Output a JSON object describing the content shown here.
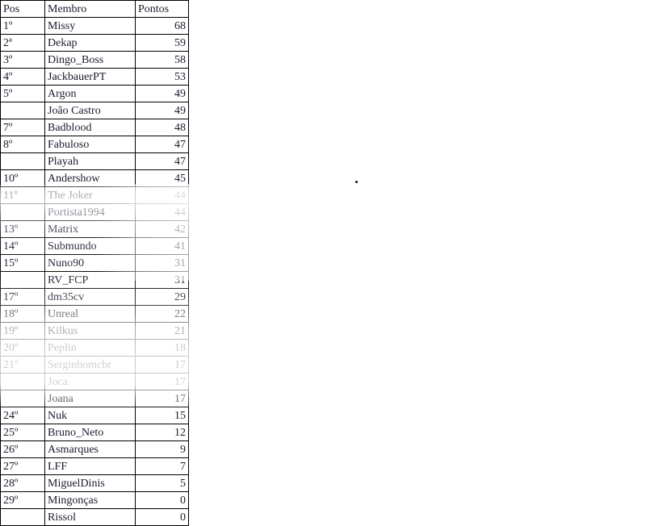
{
  "table": {
    "headers": {
      "pos": "Pos",
      "member": "Membro",
      "points": "Pontos"
    },
    "rows": [
      {
        "pos": "1º",
        "member": "Missy",
        "points": "68"
      },
      {
        "pos": "2ª",
        "member": "Dekap",
        "points": "59"
      },
      {
        "pos": "3º",
        "member": "Dingo_Boss",
        "points": "58"
      },
      {
        "pos": "4º",
        "member": "JackbauerPT",
        "points": "53"
      },
      {
        "pos": "5º",
        "member": "Argon",
        "points": "49"
      },
      {
        "pos": "",
        "member": "João Castro",
        "points": "49"
      },
      {
        "pos": "7º",
        "member": "Badblood",
        "points": "48"
      },
      {
        "pos": "8º",
        "member": "Fabuloso",
        "points": "47"
      },
      {
        "pos": "",
        "member": "Playah",
        "points": "47"
      },
      {
        "pos": "10º",
        "member": "Andershow",
        "points": "45"
      },
      {
        "pos": "11º",
        "member": "The Joker",
        "points": "44"
      },
      {
        "pos": "",
        "member": "Portista1994",
        "points": "44"
      },
      {
        "pos": "13º",
        "member": "Matrix",
        "points": "42"
      },
      {
        "pos": "14º",
        "member": "Submundo",
        "points": "41"
      },
      {
        "pos": "15º",
        "member": "Nuno90",
        "points": "31"
      },
      {
        "pos": "",
        "member": "RV_FCP",
        "points": "31"
      },
      {
        "pos": "17º",
        "member": "dm35cv",
        "points": "29"
      },
      {
        "pos": "18º",
        "member": "Unreal",
        "points": "22"
      },
      {
        "pos": "19º",
        "member": "Kilkus",
        "points": "21"
      },
      {
        "pos": "20º",
        "member": "Peplin",
        "points": "18"
      },
      {
        "pos": "21º",
        "member": "Serginhomcbr",
        "points": "17"
      },
      {
        "pos": "",
        "member": "Joca",
        "points": "17"
      },
      {
        "pos": "",
        "member": "Joana",
        "points": "17"
      },
      {
        "pos": "24º",
        "member": "Nuk",
        "points": "15"
      },
      {
        "pos": "25º",
        "member": "Bruno_Neto",
        "points": "12"
      },
      {
        "pos": "26º",
        "member": "Asmarques",
        "points": "9"
      },
      {
        "pos": "27º",
        "member": "LFF",
        "points": "7"
      },
      {
        "pos": "28º",
        "member": "MiguelDinis",
        "points": "5"
      },
      {
        "pos": "29º",
        "member": "Mingonças",
        "points": "0"
      },
      {
        "pos": "",
        "member": "Rissol",
        "points": "0"
      }
    ]
  },
  "colors": {
    "text": "#1a1a2e",
    "border": "#000000",
    "background": "#ffffff",
    "dot": "#3a3a3a"
  }
}
